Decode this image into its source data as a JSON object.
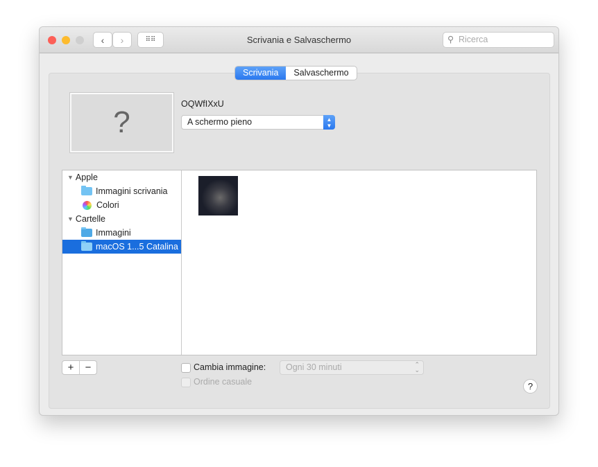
{
  "window": {
    "title": "Scrivania e Salvaschermo",
    "search_placeholder": "Ricerca"
  },
  "tabs": [
    {
      "label": "Scrivania",
      "active": true
    },
    {
      "label": "Salvaschermo",
      "active": false
    }
  ],
  "preview": {
    "placeholder": "?",
    "image_name": "OQWfIXxU"
  },
  "fit_dropdown": {
    "value": "A schermo pieno"
  },
  "sidebar": {
    "groups": [
      {
        "label": "Apple",
        "items": [
          {
            "label": "Immagini scrivania",
            "icon": "folder-icon"
          },
          {
            "label": "Colori",
            "icon": "color-wheel-icon"
          }
        ]
      },
      {
        "label": "Cartelle",
        "items": [
          {
            "label": "Immagini",
            "icon": "pictures-folder-icon"
          },
          {
            "label": "macOS 1...5 Catalina",
            "icon": "folder-icon",
            "selected": true
          }
        ]
      }
    ]
  },
  "controls": {
    "add": "+",
    "remove": "−",
    "change_picture": "Cambia immagine:",
    "interval": "Ogni 30 minuti",
    "random_order": "Ordine casuale",
    "help": "?"
  },
  "colors": {
    "accent": "#2a78ef",
    "selection": "#1a6ede"
  }
}
